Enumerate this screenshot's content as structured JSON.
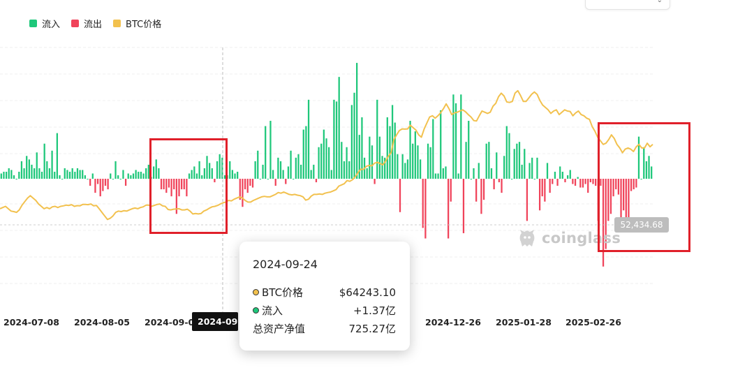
{
  "legend": [
    {
      "label": "流入",
      "color": "#1ec77a"
    },
    {
      "label": "流出",
      "color": "#f0435a"
    },
    {
      "label": "BTC价格",
      "color": "#f2c14e"
    }
  ],
  "chart_data": {
    "type": "bar",
    "series": [
      {
        "name": "流入",
        "color": "#1ec77a"
      },
      {
        "name": "流出",
        "color": "#f0435a"
      },
      {
        "name": "BTC价格",
        "color": "#f2c14e",
        "type": "line"
      }
    ],
    "x_tick_labels": [
      "2024-07-08",
      "2024-08-05",
      "2024-09-0",
      "2024-12-26",
      "2025-01-28",
      "2025-02-26"
    ],
    "bars": [
      0.03,
      0.04,
      0.04,
      0.06,
      0.05,
      0.02,
      0.0,
      0.04,
      0.1,
      0.06,
      0.13,
      0.11,
      0.08,
      0.06,
      0.15,
      0.06,
      0.04,
      0.2,
      0.1,
      0.06,
      0.16,
      0.04,
      0.26,
      0.02,
      0.0,
      0.06,
      0.05,
      0.04,
      0.06,
      0.04,
      0.06,
      0.05,
      0.05,
      0.02,
      0.0,
      -0.04,
      0.03,
      -0.08,
      -0.03,
      -0.1,
      -0.07,
      -0.04,
      -0.06,
      0.03,
      0.0,
      0.1,
      0.02,
      0.0,
      0.05,
      -0.04,
      0.03,
      0.02,
      0.03,
      0.05,
      0.04,
      0.04,
      0.03,
      0.06,
      0.08,
      0.01,
      0.07,
      0.11,
      0.06,
      -0.06,
      -0.06,
      -0.08,
      -0.05,
      -0.1,
      -0.06,
      -0.2,
      -0.1,
      -0.06,
      -0.06,
      -0.1,
      0.03,
      0.05,
      0.07,
      0.03,
      0.1,
      0.02,
      0.06,
      0.13,
      0.09,
      0.06,
      -0.02,
      0.1,
      0.14,
      0.12,
      0.02,
      0.02,
      0.1,
      0.05,
      0.03,
      0.04,
      -0.12,
      -0.16,
      -0.06,
      -0.08,
      -0.04,
      -0.05,
      0.1,
      0.16,
      0.0,
      0.08,
      0.3,
      0.0,
      0.33,
      0.05,
      -0.04,
      0.12,
      0.1,
      0.05,
      -0.03,
      0.07,
      0.16,
      0.0,
      0.12,
      0.14,
      0.08,
      0.28,
      0.3,
      0.45,
      0.05,
      0.08,
      -0.02,
      0.18,
      0.2,
      0.28,
      0.23,
      0.18,
      0.05,
      0.45,
      0.44,
      0.58,
      0.21,
      0.1,
      0.18,
      0.1,
      0.42,
      0.49,
      0.66,
      0.25,
      0.35,
      0.12,
      0.06,
      0.24,
      0.19,
      -0.03,
      0.45,
      0.24,
      0.13,
      0.12,
      0.35,
      0.3,
      0.42,
      0.32,
      0.14,
      -0.19,
      0.14,
      0.09,
      0.11,
      0.33,
      0.2,
      0.27,
      0.19,
      0.11,
      -0.28,
      -0.34,
      0.2,
      0.18,
      0.34,
      0.03,
      0.03,
      0.39,
      0.06,
      0.07,
      -0.34,
      -0.13,
      0.48,
      0.43,
      0.03,
      0.48,
      -0.31,
      0.21,
      0.33,
      0.0,
      0.06,
      -0.13,
      0.09,
      -0.2,
      -0.12,
      0.2,
      0.21,
      0.06,
      -0.06,
      0.15,
      -0.02,
      -0.08,
      0.13,
      0.3,
      0.26,
      0.0,
      0.17,
      0.2,
      0.21,
      0.08,
      0.17,
      -0.24,
      0.09,
      0.12,
      0.0,
      0.12,
      -0.18,
      -0.1,
      -0.13,
      0.09,
      -0.08,
      -0.03,
      0.04,
      -0.04,
      0.07,
      0.04,
      -0.02,
      0.02,
      0.05,
      -0.03,
      -0.04,
      0.01,
      -0.05,
      -0.05,
      -0.03,
      -0.08,
      -0.02,
      -0.03,
      -0.04,
      -0.24,
      -0.04,
      -0.5,
      -0.4,
      -0.24,
      -0.2,
      -0.1,
      -0.06,
      -0.09,
      -0.24,
      -0.18,
      -0.3,
      -0.26,
      -0.07,
      -0.06,
      -0.05,
      0.24,
      0.0,
      0.18,
      0.1,
      0.13,
      0.07
    ],
    "price_line": [
      57.0,
      57.5,
      58.0,
      57.0,
      56.0,
      55.8,
      55.5,
      56.5,
      58.5,
      60.0,
      61.5,
      62.5,
      61.5,
      60.5,
      59.0,
      58.0,
      57.0,
      57.5,
      57.0,
      57.8,
      58.0,
      57.5,
      58.0,
      58.2,
      58.5,
      58.4,
      58.7,
      58.0,
      58.3,
      58.2,
      58.8,
      58.8,
      58.7,
      59.0,
      58.2,
      58.4,
      57.0,
      55.5,
      54.0,
      52.5,
      53.0,
      54.0,
      55.5,
      56.0,
      55.8,
      56.2,
      56.0,
      56.5,
      57.0,
      57.3,
      57.0,
      57.5,
      57.8,
      58.5,
      58.5,
      58.0,
      58.4,
      58.8,
      59.0,
      58.2,
      58.0,
      56.7,
      56.5,
      56.8,
      56.9,
      57.0,
      56.5,
      56.5,
      56.8,
      56.0,
      54.8,
      55.0,
      54.8,
      55.0,
      56.0,
      56.5,
      57.2,
      57.8,
      58.0,
      58.4,
      59.0,
      59.5,
      59.8,
      60.5,
      60.3,
      61.0,
      61.5,
      62.0,
      61.5,
      60.5,
      59.8,
      59.8,
      60.5,
      61.0,
      61.5,
      62.0,
      62.2,
      62.0,
      62.0,
      62.5,
      63.0,
      63.8,
      63.5,
      64.0,
      63.5,
      63.0,
      62.8,
      63.0,
      62.7,
      62.5,
      62.0,
      60.6,
      61.0,
      62.3,
      63.0,
      63.0,
      63.2,
      63.0,
      63.5,
      63.8,
      64.0,
      64.5,
      65.0,
      66.5,
      67.0,
      67.5,
      68.8,
      68.5,
      69.2,
      70.4,
      72.2,
      73.6,
      73.5,
      74.8,
      75.2,
      75.0,
      76.1,
      76.5,
      76.0,
      75.4,
      77.0,
      79.0,
      80.5,
      86.0,
      88.0,
      89.8,
      90.5,
      90.4,
      90.5,
      92.0,
      91.0,
      90.0,
      88.0,
      87.0,
      90.5,
      93.0,
      95.5,
      96.0,
      95.0,
      96.0,
      97.3,
      99.0,
      101.0,
      99.0,
      96.5,
      97.2,
      97.5,
      98.0,
      98.5,
      97.7,
      96.5,
      95.5,
      94.0,
      93.8,
      96.0,
      98.0,
      97.5,
      97.0,
      97.5,
      100.0,
      101.2,
      104.0,
      105.5,
      104.3,
      101.8,
      101.6,
      102.0,
      105.5,
      106.5,
      104.5,
      102.0,
      102.0,
      103.5,
      105.0,
      106.0,
      105.0,
      102.5,
      100.5,
      99.5,
      98.5,
      97.0,
      98.0,
      98.5,
      96.5,
      97.5,
      98.5,
      98.0,
      97.8,
      96.0,
      97.2,
      98.0,
      96.5,
      96.0,
      95.0,
      94.5,
      91.5,
      89.5,
      87.0,
      85.5,
      84.0,
      84.5,
      86.0,
      88.0,
      86.5,
      84.0,
      82.5,
      80.5,
      82.0,
      82.5,
      82.0,
      81.0,
      83.0,
      84.0,
      82.5,
      82.5,
      84.5,
      83.0,
      84.0
    ],
    "y_range_flow": [
      -0.6,
      0.7
    ],
    "reference_price_label": "52,434.68",
    "cursor_date": "2024-09-24",
    "grid": true,
    "legend_position": "top-left"
  },
  "tooltip": {
    "date": "2024-09-24",
    "rows": [
      {
        "label": "BTC价格",
        "value": "$64243.10",
        "dot": "#f2c14e"
      },
      {
        "label": "流入",
        "value": "+1.37亿",
        "dot": "#1ec77a"
      },
      {
        "label": "总资产净值",
        "value": "725.27亿",
        "dot": ""
      }
    ]
  },
  "watermark": {
    "text": "coinglass"
  },
  "cursor_date_tag": "2024-09-24"
}
